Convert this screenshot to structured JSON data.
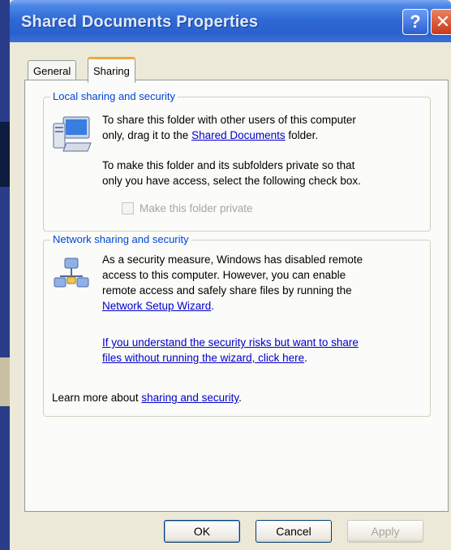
{
  "window": {
    "title": "Shared Documents Properties",
    "help_label": "?",
    "close_label": "✕"
  },
  "tabs": [
    {
      "label": "General",
      "active": false
    },
    {
      "label": "Sharing",
      "active": true
    }
  ],
  "local": {
    "legend": "Local sharing and security",
    "line1": "To share this folder with other users of this computer",
    "line2_pre": "only, drag it to the ",
    "line2_link": "Shared Documents",
    "line2_post": " folder.",
    "para2_line1": "To make this folder and its subfolders private so that",
    "para2_line2": "only you have access, select the following check box.",
    "checkbox_label": "Make this folder private"
  },
  "network": {
    "legend": "Network sharing and security",
    "line1": "As a security measure, Windows has disabled remote",
    "line2": "access to this computer. However, you can enable",
    "line3": "remote access and safely share files by running the",
    "wizard_link": "Network Setup Wizard",
    "wizard_post": ".",
    "risk_link_line1": "If you understand the security risks but want to share",
    "risk_link_line2": "files without running the wizard, click here",
    "risk_post": ".",
    "learn_pre": "Learn more about ",
    "learn_link": "sharing and security",
    "learn_post": "."
  },
  "buttons": {
    "ok": "OK",
    "cancel": "Cancel",
    "apply": "Apply"
  },
  "colors": {
    "titlebar": "#2b61cc",
    "tab_highlight": "#f0a83a",
    "group_legend": "#0046d5",
    "link": "#0000cc",
    "dialog_bg": "#ece9d8"
  }
}
